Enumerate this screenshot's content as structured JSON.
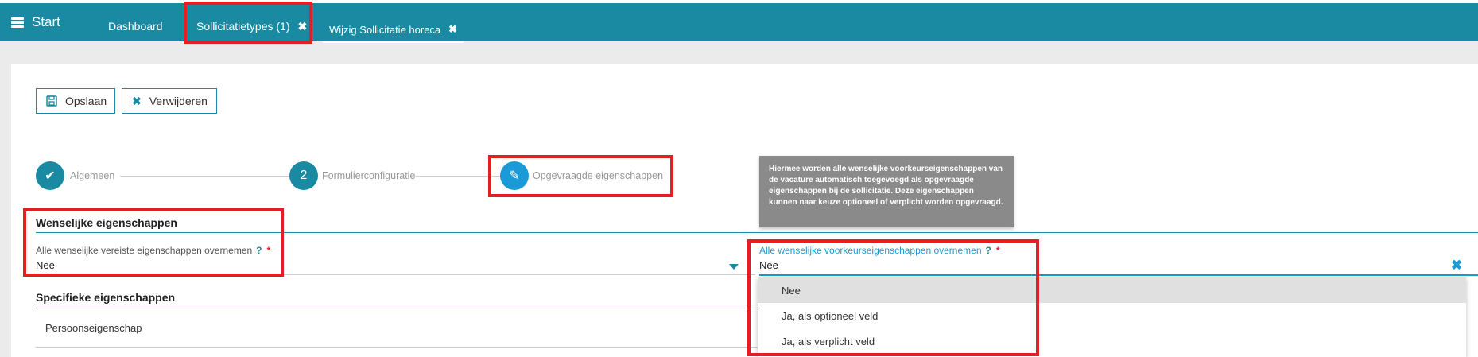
{
  "nav": {
    "start_label": "Start",
    "tabs": [
      {
        "label": "Dashboard"
      },
      {
        "label": "Sollicitatietypes (1)",
        "close": "✖"
      },
      {
        "label": "Wijzig Sollicitatie horeca",
        "close": "✖"
      }
    ],
    "menu_icon": "hamburger-icon"
  },
  "toolbar": {
    "save_label": "Opslaan",
    "save_icon": "floppy-disk-icon",
    "delete_label": "Verwijderen",
    "delete_icon": "close-icon"
  },
  "stepper": {
    "steps": [
      {
        "label": "Algemeen",
        "marker": "✔",
        "state": "done"
      },
      {
        "label": "Formulierconfiguratie",
        "marker": "2",
        "state": "pending"
      },
      {
        "label": "Opgevraagde eigenschappen",
        "marker": "✎",
        "state": "active"
      }
    ]
  },
  "tooltip": {
    "text": "Hiermee worden alle wenselijke voorkeurseigenschappen van de vacature automatisch toegevoegd als opgevraagde eigenschappen bij de sollicitatie. Deze eigenschappen kunnen naar keuze optioneel of verplicht worden opgevraagd."
  },
  "wenselijk": {
    "title": "Wenselijke eigenschappen",
    "vereiste": {
      "label": "Alle wenselijke vereiste eigenschappen overnemen",
      "help": "?",
      "required": "*",
      "value": "Nee"
    },
    "voorkeur": {
      "label": "Alle wenselijke voorkeurseigenschappen overnemen",
      "help": "?",
      "required": "*",
      "value": "Nee",
      "clear": "✖",
      "options": [
        "Nee",
        "Ja, als optioneel veld",
        "Ja, als verplicht veld"
      ],
      "selected_index": 0
    }
  },
  "specifiek": {
    "title": "Specifieke eigenschappen",
    "row_label": "Persoonseigenschap"
  },
  "colors": {
    "primary": "#1a8aa3",
    "accent_blue": "#1a9ad6",
    "highlight_red": "#e31e24",
    "tooltip_grey": "#8a8a8a"
  }
}
